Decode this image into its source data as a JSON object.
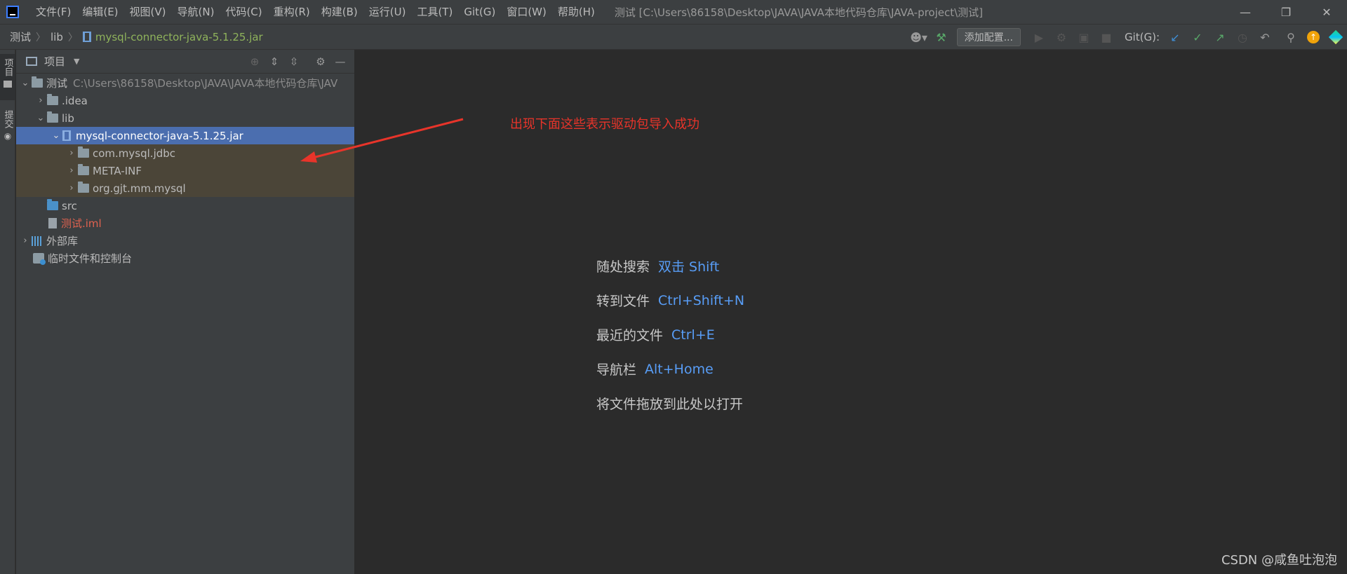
{
  "menu": [
    "文件(F)",
    "编辑(E)",
    "视图(V)",
    "导航(N)",
    "代码(C)",
    "重构(R)",
    "构建(B)",
    "运行(U)",
    "工具(T)",
    "Git(G)",
    "窗口(W)",
    "帮助(H)"
  ],
  "window_title": "测试 [C:\\Users\\86158\\Desktop\\JAVA\\JAVA本地代码仓库\\JAVA-project\\测试]",
  "breadcrumb": {
    "project": "测试",
    "folder": "lib",
    "file": "mysql-connector-java-5.1.25.jar"
  },
  "toolbar": {
    "add_config": "添加配置...",
    "git_label": "Git(G):"
  },
  "left_strip": {
    "tab_project": "项目",
    "tab_commit": "提交"
  },
  "panel": {
    "title": "项目"
  },
  "tree": {
    "root_name": "测试",
    "root_path": "C:\\Users\\86158\\Desktop\\JAVA\\JAVA本地代码仓库\\JAV",
    "idea": ".idea",
    "lib": "lib",
    "jar": "mysql-connector-java-5.1.25.jar",
    "pkg1": "com.mysql.jdbc",
    "pkg2": "META-INF",
    "pkg3": "org.gjt.mm.mysql",
    "src": "src",
    "iml": "测试.iml",
    "external": "外部库",
    "scratches": "临时文件和控制台"
  },
  "annotation": "出现下面这些表示驱动包导入成功",
  "hints": [
    {
      "label": "随处搜索",
      "key": "双击 Shift"
    },
    {
      "label": "转到文件",
      "key": "Ctrl+Shift+N"
    },
    {
      "label": "最近的文件",
      "key": "Ctrl+E"
    },
    {
      "label": "导航栏",
      "key": "Alt+Home"
    },
    {
      "label": "将文件拖放到此处以打开",
      "key": ""
    }
  ],
  "watermark": "CSDN @咸鱼吐泡泡",
  "colors": {
    "selection": "#4b6eaf",
    "annotation": "#e8342a",
    "shortcut": "#589df6",
    "iml_file": "#e0624f"
  }
}
